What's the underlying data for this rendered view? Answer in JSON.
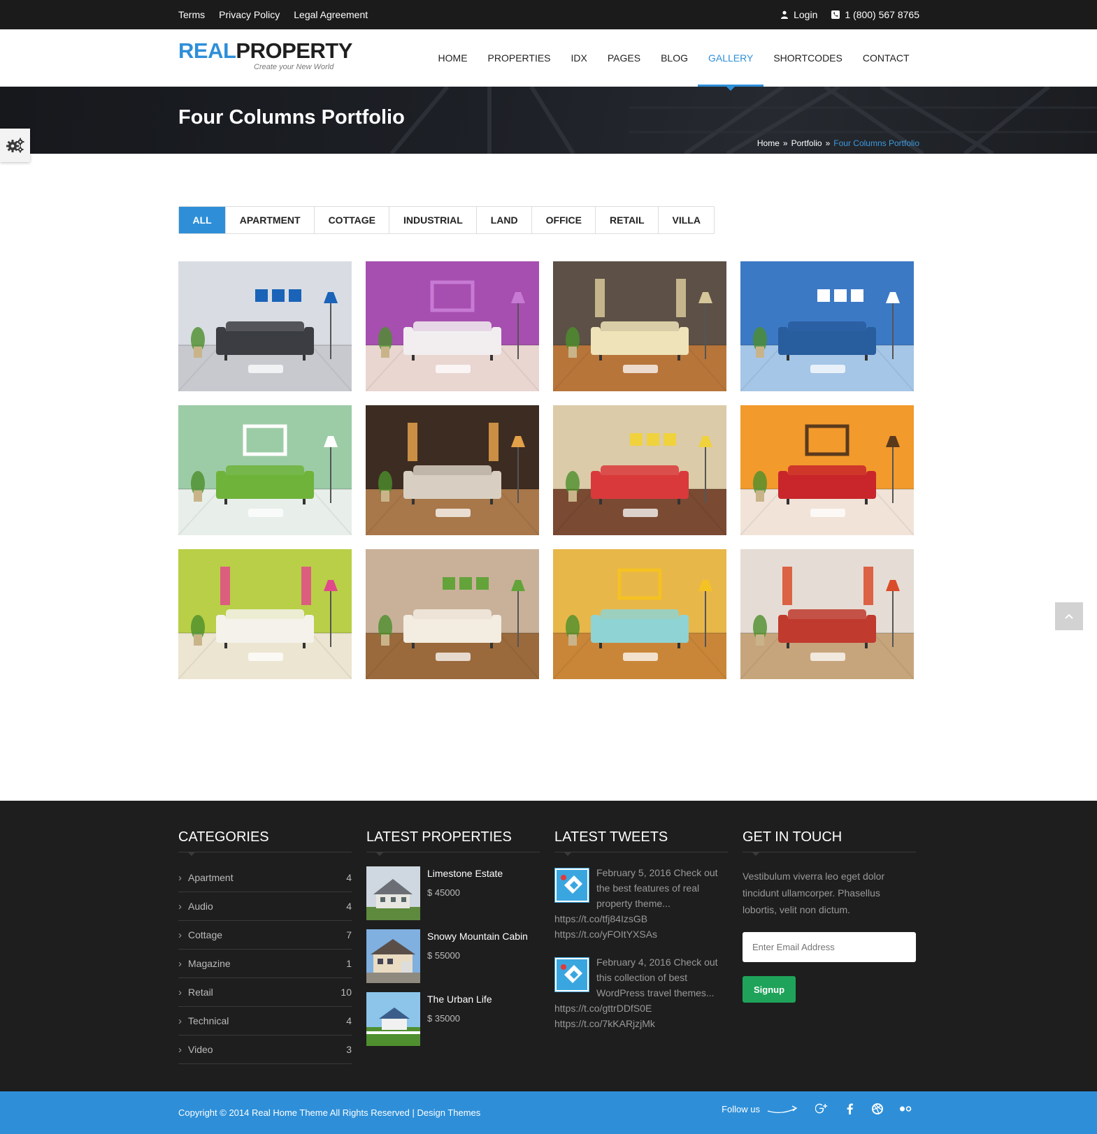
{
  "topbar": {
    "links": [
      "Terms",
      "Privacy Policy",
      "Legal Agreement"
    ],
    "login": "Login",
    "phone": "1 (800) 567 8765"
  },
  "logo": {
    "part1": "REAL",
    "part2": "PROPERTY",
    "tagline": "Create your New World"
  },
  "nav": {
    "items": [
      "HOME",
      "PROPERTIES",
      "IDX",
      "PAGES",
      "BLOG",
      "GALLERY",
      "SHORTCODES",
      "CONTACT"
    ],
    "active": "GALLERY"
  },
  "banner": {
    "title": "Four Columns Portfolio",
    "breadcrumb": [
      "Home",
      "Portfolio",
      "Four Columns Portfolio"
    ]
  },
  "filters": {
    "items": [
      "ALL",
      "APARTMENT",
      "COTTAGE",
      "INDUSTRIAL",
      "LAND",
      "OFFICE",
      "RETAIL",
      "VILLA"
    ],
    "active": "ALL"
  },
  "gallery": {
    "items": [
      {
        "wall": "#d9dde3",
        "floor": "#c7c9ce",
        "sofa": "#3b3d42",
        "accent": "#1a63b8"
      },
      {
        "wall": "#a64fb0",
        "floor": "#e9d6d1",
        "sofa": "#f2eef0",
        "accent": "#c77ad4"
      },
      {
        "wall": "#5c5047",
        "floor": "#b8753a",
        "sofa": "#efe3b9",
        "accent": "#d6c79a"
      },
      {
        "wall": "#3c79c5",
        "floor": "#a5c6e6",
        "sofa": "#285d9e",
        "accent": "#ffffff"
      },
      {
        "wall": "#9ccca6",
        "floor": "#e8efea",
        "sofa": "#6fb33a",
        "accent": "#ffffff"
      },
      {
        "wall": "#3d2c22",
        "floor": "#a8774a",
        "sofa": "#d8cfc2",
        "accent": "#e3a14a"
      },
      {
        "wall": "#dccba8",
        "floor": "#7a4a33",
        "sofa": "#d9393b",
        "accent": "#f0d23d"
      },
      {
        "wall": "#f29a2c",
        "floor": "#f1e3d8",
        "sofa": "#c8262a",
        "accent": "#5b3a1c"
      },
      {
        "wall": "#b9cf47",
        "floor": "#ece5d1",
        "sofa": "#f5f2ec",
        "accent": "#e04a8a"
      },
      {
        "wall": "#c9b199",
        "floor": "#9a6a3c",
        "sofa": "#f3ece0",
        "accent": "#63a33a"
      },
      {
        "wall": "#e8b74a",
        "floor": "#c98638",
        "sofa": "#8fd3d4",
        "accent": "#f5c223"
      },
      {
        "wall": "#e5ddd5",
        "floor": "#c7a57c",
        "sofa": "#c03a2e",
        "accent": "#d94c2a"
      }
    ]
  },
  "footer": {
    "categories": {
      "title": "CATEGORIES",
      "items": [
        {
          "name": "Apartment",
          "count": "4"
        },
        {
          "name": "Audio",
          "count": "4"
        },
        {
          "name": "Cottage",
          "count": "7"
        },
        {
          "name": "Magazine",
          "count": "1"
        },
        {
          "name": "Retail",
          "count": "10"
        },
        {
          "name": "Technical",
          "count": "4"
        },
        {
          "name": "Video",
          "count": "3"
        }
      ]
    },
    "properties": {
      "title": "LATEST PROPERTIES",
      "items": [
        {
          "name": "Limestone Estate",
          "price": "$ 45000"
        },
        {
          "name": "Snowy Mountain Cabin",
          "price": "$ 55000"
        },
        {
          "name": "The Urban Life",
          "price": "$ 35000"
        }
      ]
    },
    "tweets": {
      "title": "LATEST TWEETS",
      "items": [
        {
          "text": "February 5, 2016 Check out the best features of real property theme... https://t.co/tfj84IzsGB https://t.co/yFOItYXSAs"
        },
        {
          "text": "February 4, 2016 Check out this collection of best WordPress travel themes... https://t.co/gttrDDfS0E https://t.co/7kKARjzjMk"
        }
      ]
    },
    "touch": {
      "title": "GET IN TOUCH",
      "text": "Vestibulum viverra leo eget dolor tincidunt ullamcorper. Phasellus lobortis, velit non dictum.",
      "email_placeholder": "Enter Email Address",
      "signup_label": "Signup"
    }
  },
  "bottom": {
    "copyright": "Copyright © 2014 Real Home Theme All Rights Reserved | Design Themes",
    "follow_label": "Follow us",
    "social_icons": [
      "google-plus-icon",
      "facebook-icon",
      "dribbble-icon",
      "flickr-icon"
    ]
  },
  "colors": {
    "accent": "#2e8fd8",
    "dark": "#1e1e1e",
    "signup": "#1fa35a"
  }
}
